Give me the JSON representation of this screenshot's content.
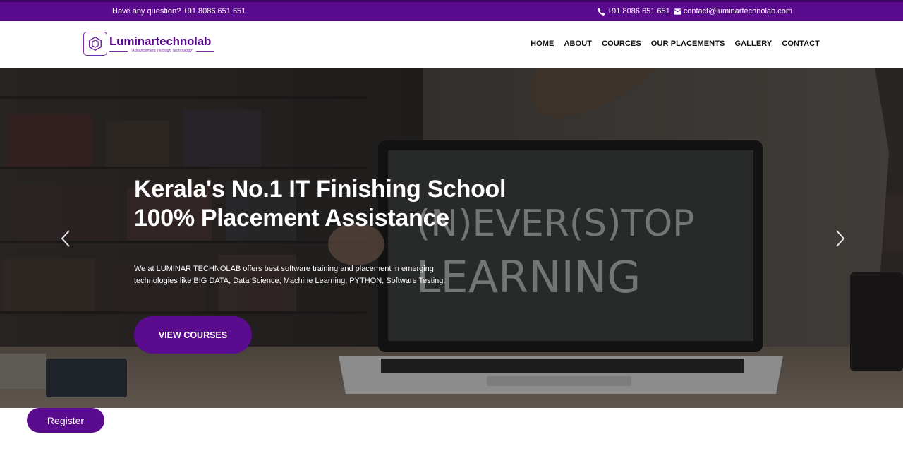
{
  "topbar": {
    "question": "Have any question? +91 8086 651 651",
    "phone": "+91 8086 651 651",
    "email": "contact@luminartechnolab.com",
    "icons": [
      "phone-icon",
      "envelope-icon"
    ]
  },
  "brand": {
    "name": "Luminartechnolab",
    "tagline": "\"Advancement Through Technology\"",
    "color": "#5b0b8e"
  },
  "nav": {
    "items": [
      "HOME",
      "ABOUT",
      "COURCES",
      "OUR PLACEMENTS",
      "GALLERY",
      "CONTACT"
    ]
  },
  "hero": {
    "title_line1": "Kerala's No.1 IT Finishing School",
    "title_line2": "100% Placement Assistance",
    "description": "We at LUMINAR TECHNOLAB offers best software training and placement in emerging technologies like BIG DATA, Data Science, Machine Learning, PYTHON, Software Testing.",
    "button": "VIEW COURSES",
    "image_text": "(N)EVER(S)TOP LEARNING",
    "controls": [
      "chevron-left-icon",
      "chevron-right-icon"
    ]
  },
  "register": {
    "label": "Register"
  }
}
